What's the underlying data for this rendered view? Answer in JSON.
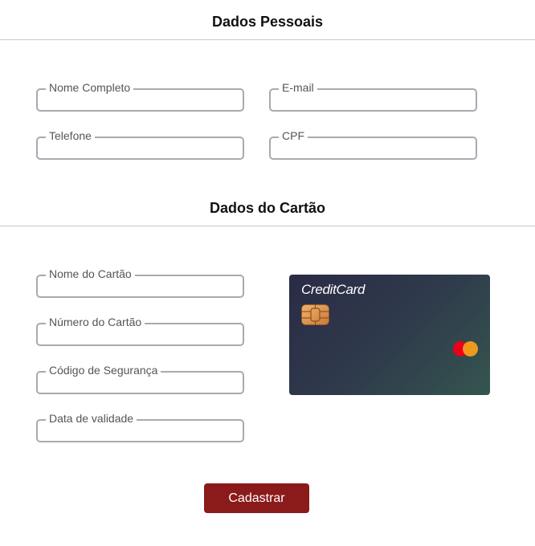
{
  "personal": {
    "title": "Dados Pessoais",
    "fields": [
      {
        "label": "Nome Completo",
        "value": ""
      },
      {
        "label": "E-mail",
        "value": ""
      },
      {
        "label": "Telefone",
        "value": ""
      },
      {
        "label": "CPF",
        "value": ""
      }
    ]
  },
  "card_section": {
    "title": "Dados do Cartão",
    "fields": [
      {
        "label": "Nome do Cartão",
        "value": ""
      },
      {
        "label": "Número do Cartão",
        "value": ""
      },
      {
        "label": "Código de Segurança",
        "value": ""
      },
      {
        "label": "Data de validade",
        "value": ""
      }
    ]
  },
  "card_preview": {
    "brand_text": "CreditCard",
    "chip_icon": "chip-icon",
    "network_icon": "mastercard-icon",
    "gradient_colors": [
      "#2a2b45",
      "#35554e"
    ]
  },
  "submit": {
    "label": "Cadastrar",
    "color": "#8b1a1a"
  }
}
